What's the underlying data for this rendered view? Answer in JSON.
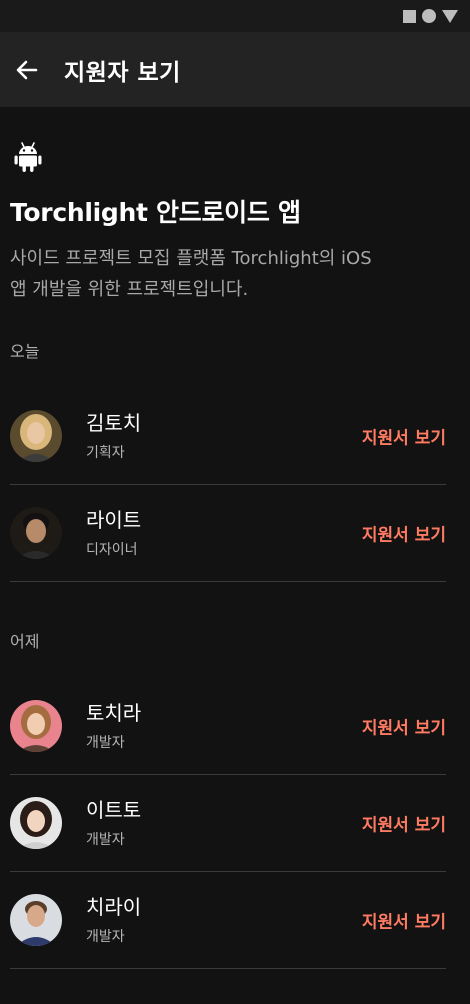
{
  "status_bar": {
    "icons": [
      "square-icon",
      "circle-icon",
      "triangle-icon"
    ]
  },
  "app_bar": {
    "title": "지원자 보기",
    "back_icon": "arrow-left-icon"
  },
  "project": {
    "platform_icon": "android-icon",
    "title": "Torchlight 안드로이드 앱",
    "description": "사이드 프로젝트 모집 플랫폼 Torchlight의 iOS 앱 개발을 위한 프로젝트입니다."
  },
  "sections": {
    "today": {
      "label": "오늘",
      "applicants": [
        {
          "name": "김토치",
          "role": "기획자",
          "action": "지원서 보기"
        },
        {
          "name": "라이트",
          "role": "디자이너",
          "action": "지원서 보기"
        }
      ]
    },
    "yesterday": {
      "label": "어제",
      "applicants": [
        {
          "name": "토치라",
          "role": "개발자",
          "action": "지원서 보기"
        },
        {
          "name": "이트토",
          "role": "개발자",
          "action": "지원서 보기"
        },
        {
          "name": "치라이",
          "role": "개발자",
          "action": "지원서 보기"
        }
      ]
    }
  },
  "colors": {
    "background": "#121212",
    "app_bar": "#232323",
    "accent": "#ff7b61",
    "divider": "#3a3a3a"
  }
}
